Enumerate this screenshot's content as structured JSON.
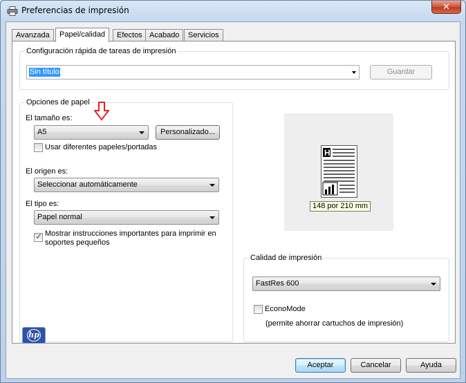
{
  "window": {
    "title": "Preferencias de impresión",
    "close_label": "✕"
  },
  "tabs": [
    {
      "label": "Avanzada",
      "active": false
    },
    {
      "label": "Papel/calidad",
      "active": true
    },
    {
      "label": "Efectos",
      "active": false
    },
    {
      "label": "Acabado",
      "active": false
    },
    {
      "label": "Servicios",
      "active": false
    }
  ],
  "quick_sets": {
    "legend": "Configuración rápida de tareas de impresión",
    "value": "Sin título",
    "save_label": "Guardar"
  },
  "paper_options": {
    "legend": "Opciones de papel",
    "size_label": "El tamaño es:",
    "size_value": "A5",
    "custom_label": "Personalizado...",
    "different_papers_label": "Usar diferentes papeles/portadas",
    "different_papers_checked": false,
    "source_label": "El origen es:",
    "source_value": "Seleccionar automáticamente",
    "type_label": "El tipo es:",
    "type_value": "Papel normal",
    "show_instructions_label_1": "Mostrar instrucciones importantes para imprimir en",
    "show_instructions_label_2": "soportes pequeños",
    "show_instructions_checked": true
  },
  "preview": {
    "size_text": "148 por 210 mm"
  },
  "print_quality": {
    "legend": "Calidad de impresión",
    "value": "FastRes 600",
    "economode_label": "EconoMode",
    "economode_checked": false,
    "economode_note": "(permite ahorrar cartuchos de impresión)"
  },
  "footer": {
    "accept_label": "Aceptar",
    "cancel_label": "Cancelar",
    "help_label": "Ayuda",
    "logo_text": "hp"
  },
  "colors": {
    "annotation_arrow": "#e8231f",
    "selection": "#3399ff"
  }
}
